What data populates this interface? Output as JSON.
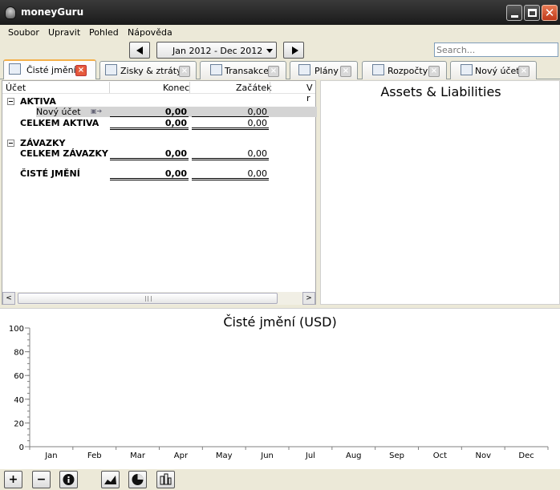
{
  "window": {
    "title": "moneyGuru"
  },
  "menu": [
    "Soubor",
    "Upravit",
    "Pohled",
    "Nápověda"
  ],
  "toolbar": {
    "date_range": "Jan 2012 - Dec 2012",
    "search_placeholder": "Search..."
  },
  "tabs": [
    {
      "label": "Čisté jmění",
      "icon": "networth-icon",
      "active": true
    },
    {
      "label": "Zisky & ztráty",
      "icon": "profit-icon",
      "active": false
    },
    {
      "label": "Transakce",
      "icon": "transaction-icon",
      "active": false
    },
    {
      "label": "Plány",
      "icon": "schedule-icon",
      "active": false
    },
    {
      "label": "Rozpočty",
      "icon": "budget-icon",
      "active": false
    },
    {
      "label": "Nový účet",
      "icon": "account-icon",
      "active": false
    }
  ],
  "sheet": {
    "columns": [
      "Účet",
      "Konec",
      "Začátek",
      "V r"
    ],
    "assets_header": "AKTIVA",
    "new_account": {
      "name": "Nový účet",
      "end": "0,00",
      "start": "0,00"
    },
    "assets_total": {
      "name": "CELKEM AKTIVA",
      "end": "0,00",
      "start": "0,00"
    },
    "liabilities_header": "ZÁVAZKY",
    "liabilities_total": {
      "name": "CELKEM ZÁVAZKY",
      "end": "0,00",
      "start": "0,00"
    },
    "net_worth": {
      "name": "ČISTÉ JMĚNÍ",
      "end": "0,00",
      "start": "0,00"
    }
  },
  "pie_panel": {
    "title": "Assets & Liabilities"
  },
  "chart_data": {
    "type": "bar",
    "title": "Čisté jmění (USD)",
    "categories": [
      "Jan",
      "Feb",
      "Mar",
      "Apr",
      "May",
      "Jun",
      "Jul",
      "Aug",
      "Sep",
      "Oct",
      "Nov",
      "Dec"
    ],
    "values": [
      0,
      0,
      0,
      0,
      0,
      0,
      0,
      0,
      0,
      0,
      0,
      0
    ],
    "yticks": [
      0,
      20,
      40,
      60,
      80,
      100
    ],
    "ylim": [
      0,
      100
    ],
    "xlabel": "",
    "ylabel": "",
    "grid": false
  },
  "bottom_buttons": [
    {
      "label": "+",
      "icon": "add-icon"
    },
    {
      "label": "−",
      "icon": "remove-icon"
    },
    {
      "label": "",
      "icon": "info-icon"
    },
    {
      "label": "",
      "icon": "area-chart-icon"
    },
    {
      "label": "",
      "icon": "pie-chart-icon"
    },
    {
      "label": "",
      "icon": "columns-icon"
    }
  ]
}
